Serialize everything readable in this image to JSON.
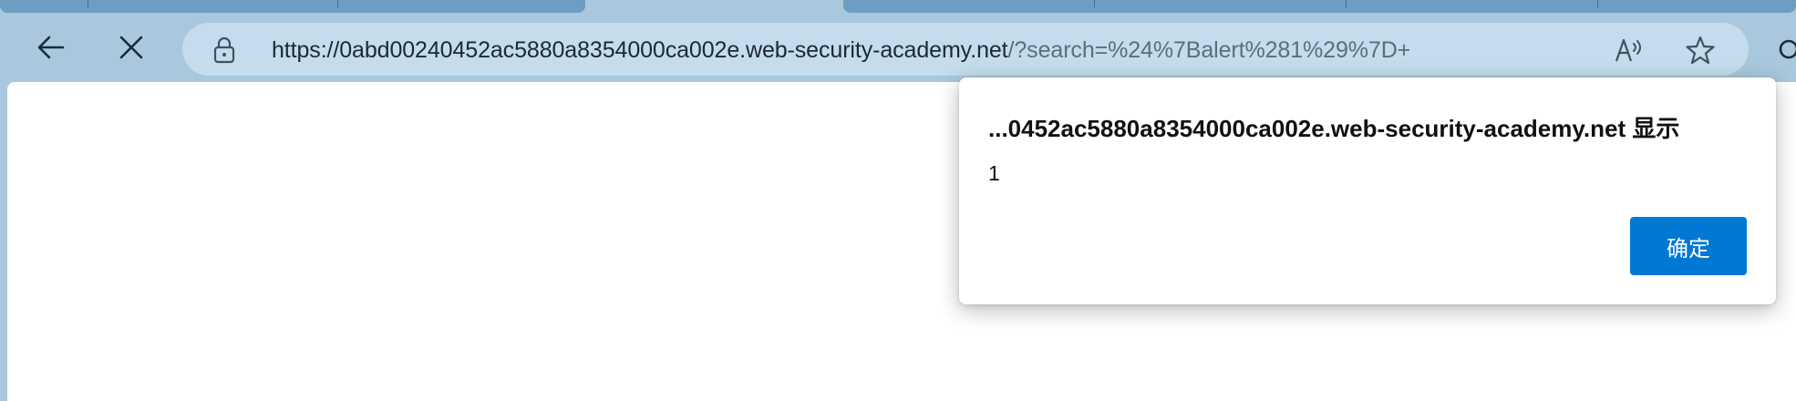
{
  "address_bar": {
    "url_host": "https://0abd00240452ac5880a8354000ca002e.web-security-academy.net",
    "url_rest": "/?search=%24%7Balert%281%29%7D+"
  },
  "dialog": {
    "title": "...0452ac5880a8354000ca002e.web-security-academy.net 显示",
    "message": "1",
    "ok_label": "确定"
  },
  "colors": {
    "toolbar_bg": "#a9c8dd",
    "address_bg": "#c4dceb",
    "ok_button": "#0078d4"
  },
  "icons": [
    "back-arrow-icon",
    "close-icon",
    "lock-icon",
    "read-aloud-icon",
    "favorite-star-icon",
    "search-icon"
  ]
}
